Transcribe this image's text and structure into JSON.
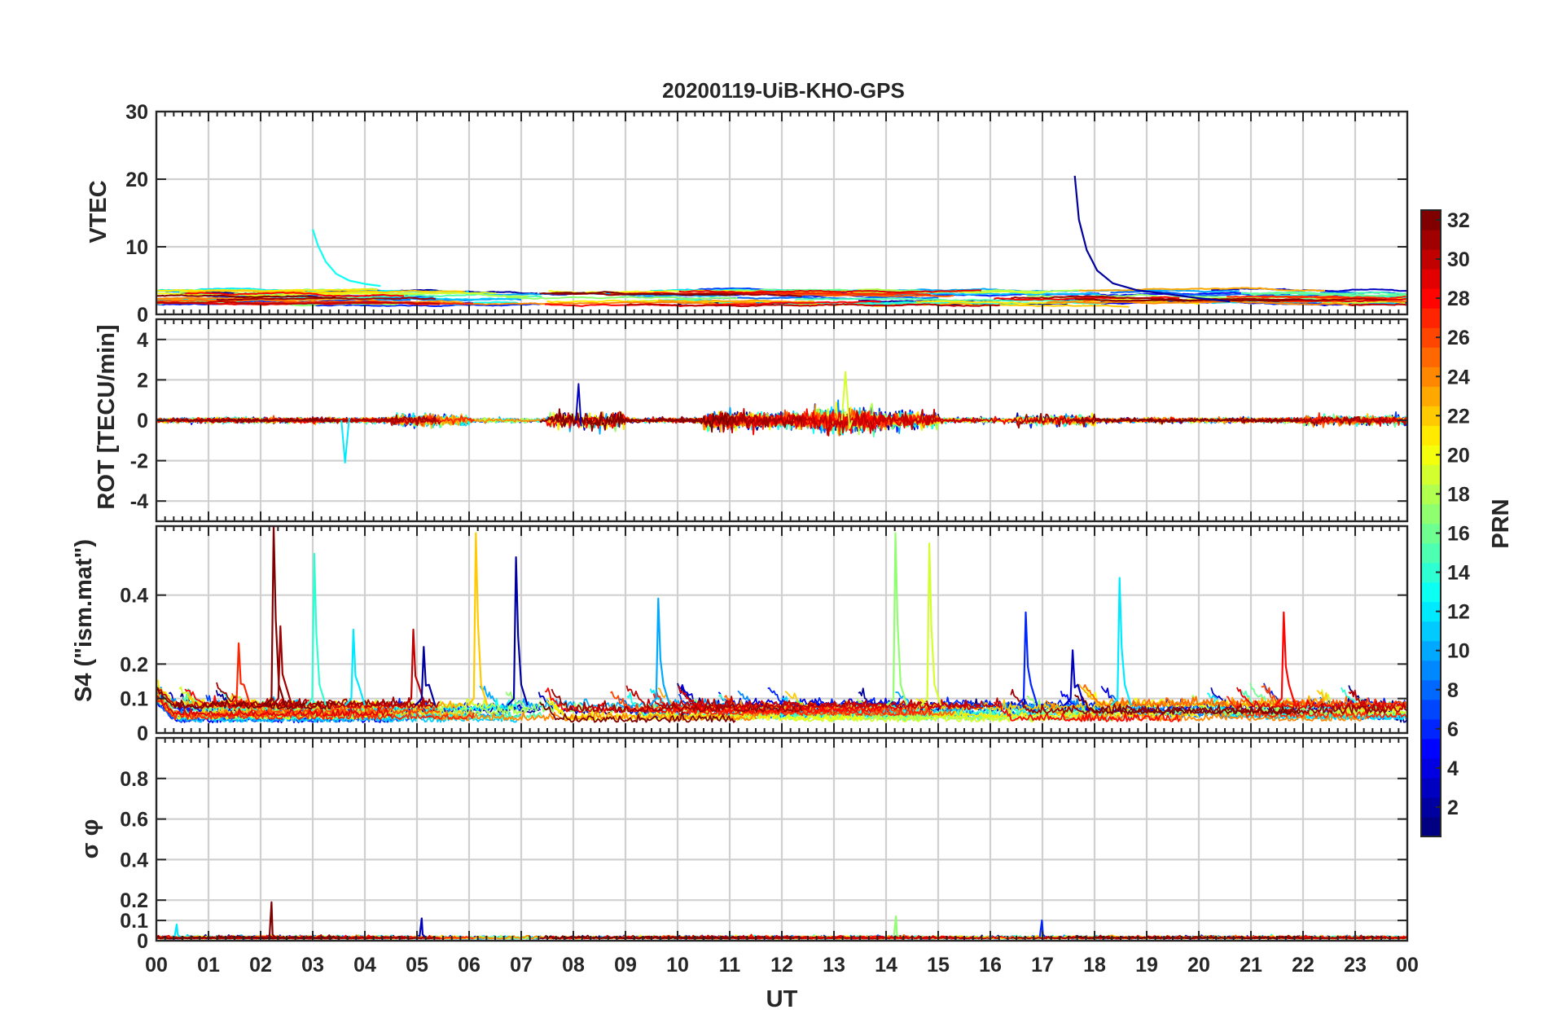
{
  "chart_data": {
    "type": "line",
    "title": "20200119-UiB-KHO-GPS",
    "xlabel": "UT",
    "x_tick_labels": [
      "00",
      "01",
      "02",
      "03",
      "04",
      "05",
      "06",
      "07",
      "08",
      "09",
      "10",
      "11",
      "12",
      "13",
      "14",
      "15",
      "16",
      "17",
      "18",
      "19",
      "20",
      "21",
      "22",
      "23",
      "00"
    ],
    "xlim": [
      0,
      24
    ],
    "grid": true,
    "colorbar": {
      "label": "PRN",
      "range": [
        1,
        32
      ],
      "tick_labels": [
        "2",
        "4",
        "6",
        "8",
        "10",
        "12",
        "14",
        "16",
        "18",
        "20",
        "22",
        "24",
        "26",
        "28",
        "30",
        "32"
      ],
      "colormap": "jet",
      "placement": "right"
    },
    "panels": [
      {
        "id": "vtec",
        "ylabel": "VTEC",
        "ylim": [
          0,
          30
        ],
        "y_ticks": [
          0,
          10,
          20,
          30
        ],
        "y_tick_labels": [
          "0",
          "10",
          "20",
          "30"
        ],
        "notes": "Background ~1-5 TECU for all PRNs; decaying spikes near 03 UT (~12.5) and 17.6 UT (~20.5)",
        "highlight_series": [
          {
            "prn": 13,
            "points": [
              [
                3.0,
                12.6
              ],
              [
                3.1,
                10.2
              ],
              [
                3.25,
                7.8
              ],
              [
                3.45,
                6.0
              ],
              [
                3.7,
                5.0
              ],
              [
                4.0,
                4.5
              ],
              [
                4.3,
                4.2
              ]
            ]
          },
          {
            "prn": 2,
            "points": [
              [
                17.62,
                20.5
              ],
              [
                17.7,
                14.0
              ],
              [
                17.85,
                9.5
              ],
              [
                18.05,
                6.5
              ],
              [
                18.35,
                4.6
              ],
              [
                18.8,
                3.6
              ],
              [
                19.4,
                3.0
              ],
              [
                20.0,
                2.4
              ],
              [
                20.6,
                1.9
              ]
            ]
          }
        ]
      },
      {
        "id": "rot",
        "ylabel": "ROT [TECU/min]",
        "ylim": [
          -5,
          5
        ],
        "y_ticks": [
          -4,
          -2,
          0,
          2,
          4
        ],
        "y_tick_labels": [
          "-4",
          "-2",
          "0",
          "2",
          "4"
        ],
        "notes": "Fluctuations around 0, mostly within ±1 TECU/min; peaks near 2.4 around 13.2 UT and -2.1 around 03.6 UT"
      },
      {
        "id": "s4",
        "ylabel": "S4 (\"ism.mat\")",
        "ylim": [
          0,
          0.6
        ],
        "y_ticks": [
          0,
          0.1,
          0.2,
          0.4
        ],
        "y_tick_labels": [
          "0",
          "0.1",
          "0.2",
          "0.4"
        ],
        "notes": "Background 0.03-0.15; spikes at ~02.3 UT (0.6, PRN 32), 03.0 (0.52), 06.1 (0.58), 06.9 (0.51), 14.2 (0.58), 14.8 (0.55), 18.5 (0.45)",
        "spikes": [
          {
            "t": 1.6,
            "v": 0.26,
            "prn": 27
          },
          {
            "t": 2.27,
            "v": 0.6,
            "prn": 32
          },
          {
            "t": 2.4,
            "v": 0.31,
            "prn": 31
          },
          {
            "t": 3.05,
            "v": 0.52,
            "prn": 14
          },
          {
            "t": 3.8,
            "v": 0.3,
            "prn": 12
          },
          {
            "t": 4.95,
            "v": 0.3,
            "prn": 30
          },
          {
            "t": 5.15,
            "v": 0.25,
            "prn": 2
          },
          {
            "t": 6.15,
            "v": 0.58,
            "prn": 22
          },
          {
            "t": 6.92,
            "v": 0.51,
            "prn": 2
          },
          {
            "t": 9.65,
            "v": 0.39,
            "prn": 10
          },
          {
            "t": 14.2,
            "v": 0.58,
            "prn": 17
          },
          {
            "t": 14.85,
            "v": 0.55,
            "prn": 19
          },
          {
            "t": 16.7,
            "v": 0.35,
            "prn": 6
          },
          {
            "t": 17.6,
            "v": 0.24,
            "prn": 3
          },
          {
            "t": 18.5,
            "v": 0.45,
            "prn": 12
          },
          {
            "t": 21.65,
            "v": 0.35,
            "prn": 28
          }
        ]
      },
      {
        "id": "sigma_phi",
        "ylabel": "σ φ",
        "ylim": [
          0,
          1
        ],
        "y_ticks": [
          0,
          0.1,
          0.2,
          0.4,
          0.6,
          0.8
        ],
        "y_tick_labels": [
          "0",
          "0.1",
          "0.2",
          "0.4",
          "0.6",
          "0.8"
        ],
        "notes": "Mostly below 0.05; spike ~0.19 at 02.2 UT (PRN 32), ~0.1 near 05.1 and 17.0 UT",
        "spikes": [
          {
            "t": 2.22,
            "v": 0.19,
            "prn": 32
          },
          {
            "t": 5.1,
            "v": 0.11,
            "prn": 3
          },
          {
            "t": 14.2,
            "v": 0.12,
            "prn": 17
          },
          {
            "t": 17.0,
            "v": 0.1,
            "prn": 6
          },
          {
            "t": 0.4,
            "v": 0.08,
            "prn": 12
          }
        ]
      }
    ]
  }
}
